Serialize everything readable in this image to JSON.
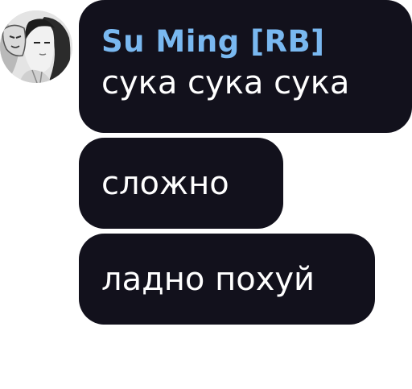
{
  "chat": {
    "sender": {
      "name": "Su Ming [RB]",
      "name_color": "#79b8f0",
      "avatar_icon": "avatar-illustration"
    },
    "bubble_color": "#12111c",
    "messages": [
      {
        "text": "сука сука сука"
      },
      {
        "text": "сложно"
      },
      {
        "text": "ладно похуй"
      }
    ]
  }
}
